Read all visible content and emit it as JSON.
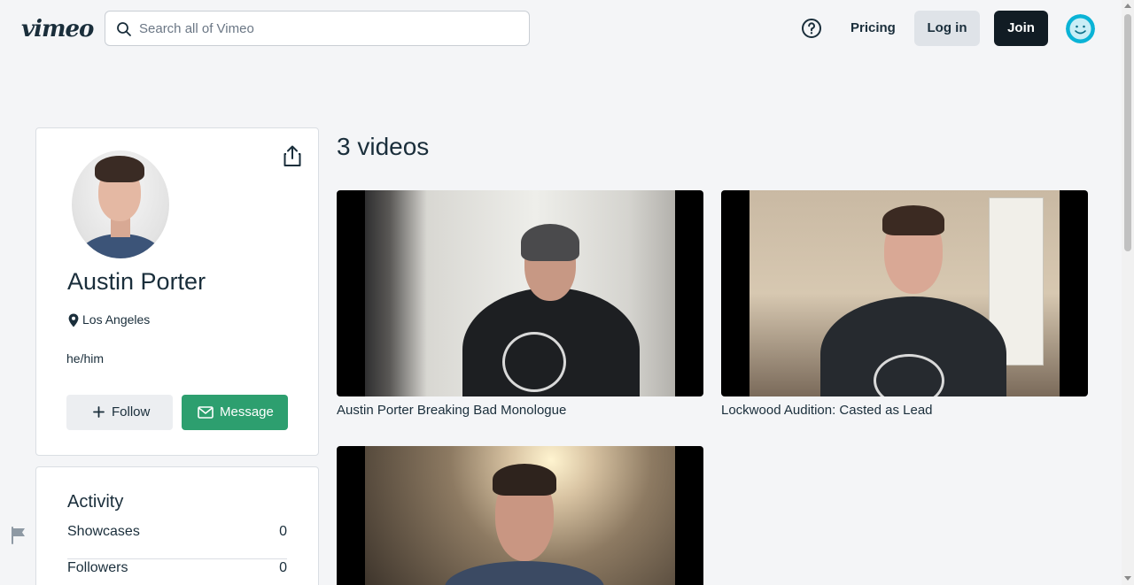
{
  "header": {
    "logo_text": "vimeo",
    "search": {
      "placeholder": "Search all of Vimeo",
      "value": ""
    },
    "help_icon": "question-circle-icon",
    "pricing_label": "Pricing",
    "login_label": "Log in",
    "join_label": "Join"
  },
  "profile": {
    "name": "Austin Porter",
    "location": "Los Angeles",
    "pronouns": "he/him",
    "follow_label": "Follow",
    "message_label": "Message",
    "colors": {
      "message_button": "#2d9f6f",
      "join_button": "#111c24",
      "avatar_accent": "#0ab3d6"
    }
  },
  "activity": {
    "title": "Activity",
    "rows": [
      {
        "label": "Showcases",
        "value": "0"
      },
      {
        "label": "Followers",
        "value": "0"
      }
    ]
  },
  "videos": {
    "count_label": "3 videos",
    "items": [
      {
        "title": "Austin Porter Breaking Bad Monologue"
      },
      {
        "title": "Lockwood Audition: Casted as Lead"
      },
      {
        "title": ""
      }
    ]
  }
}
